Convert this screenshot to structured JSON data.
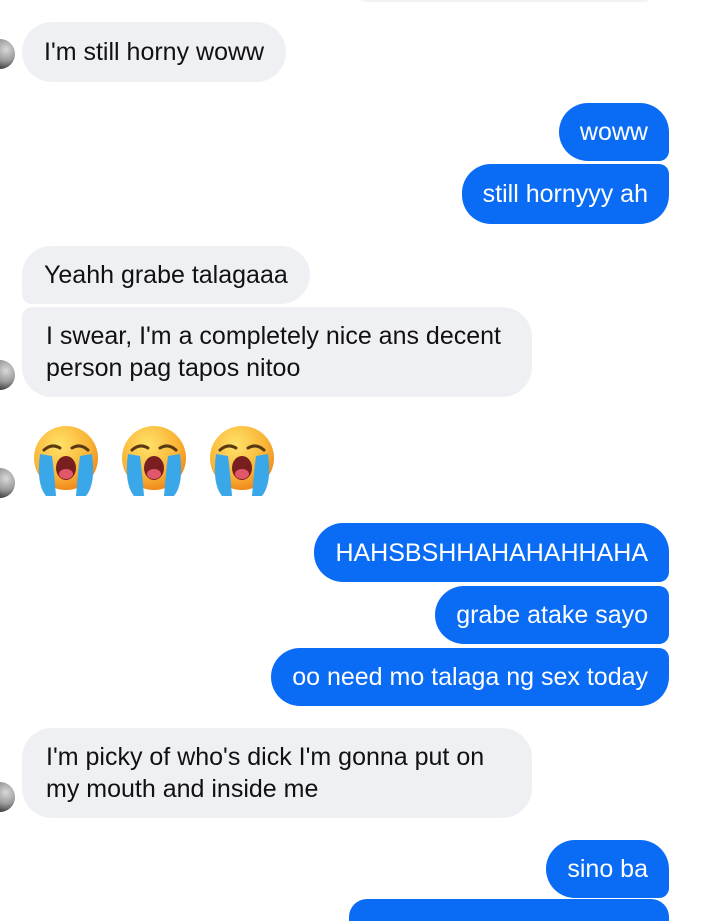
{
  "conversation": {
    "messages": [
      {
        "sender": "other",
        "text": "I'm still horny woww"
      },
      {
        "sender": "me",
        "text": "woww"
      },
      {
        "sender": "me",
        "text": "still hornyyy ah"
      },
      {
        "sender": "other",
        "text": "Yeahh grabe talagaaa"
      },
      {
        "sender": "other",
        "text": "I swear, I'm a completely nice ans decent person pag tapos nitoo"
      },
      {
        "sender": "other",
        "type": "emoji",
        "emoji": [
          "loudly-crying-face",
          "loudly-crying-face",
          "loudly-crying-face"
        ]
      },
      {
        "sender": "me",
        "text": "HAHSBSHHAHAHAHHAHA"
      },
      {
        "sender": "me",
        "text": "grabe atake sayo"
      },
      {
        "sender": "me",
        "text": "oo need mo talaga ng sex today"
      },
      {
        "sender": "other",
        "text": "I'm picky of who's dick I'm gonna put on my mouth and inside me"
      },
      {
        "sender": "me",
        "text": "sino ba"
      }
    ]
  },
  "colors": {
    "outgoing_bubble": "#0a6cf5",
    "incoming_bubble": "#eff0f3",
    "incoming_text": "#111111",
    "outgoing_text": "#ffffff"
  }
}
